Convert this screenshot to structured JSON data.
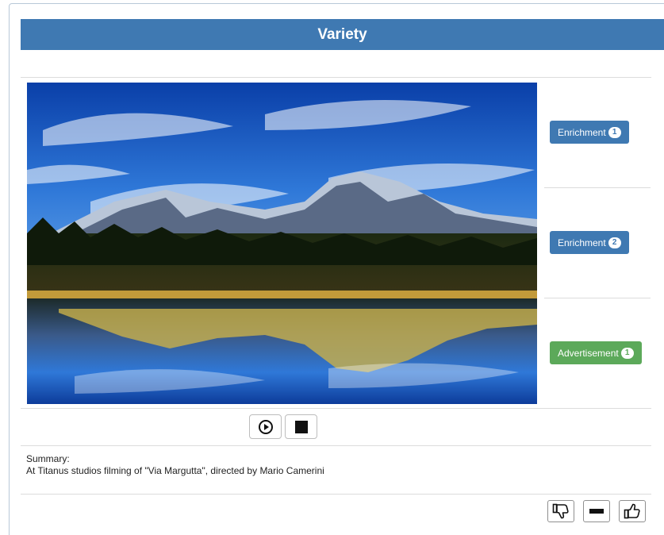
{
  "panel": {
    "title": "Variety"
  },
  "media": {
    "image_alt": "mountain-lake-reflection-image"
  },
  "side_buttons": [
    {
      "label": "Enrichment",
      "count": "1",
      "color": "#3f79b2"
    },
    {
      "label": "Enrichment",
      "count": "2",
      "color": "#3f79b2"
    },
    {
      "label": "Advertisement",
      "count": "1",
      "color": "#5ca95a"
    }
  ],
  "controls": {
    "play_icon": "play-circle-icon",
    "stop_icon": "stop-icon"
  },
  "summary": {
    "label": "Summary:",
    "text": "At Titanus studios filming of \"Via Margutta\", directed by Mario Camerini"
  },
  "rating": {
    "dislike_icon": "thumbs-down-icon",
    "neutral_icon": "minus-icon",
    "like_icon": "thumbs-up-icon"
  },
  "colors": {
    "header": "#3f79b2",
    "accent_green": "#5ca95a"
  }
}
